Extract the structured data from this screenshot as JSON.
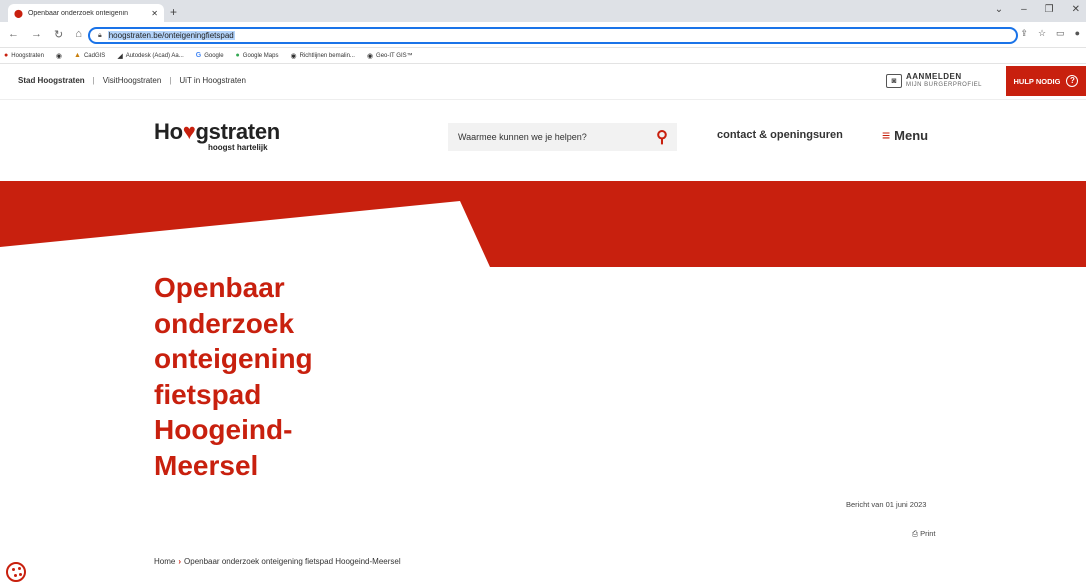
{
  "browser": {
    "tab_title": "Openbaar onderzoek onteigenin",
    "new_tab": "+",
    "url": "hoogstraten.be/onteigeningfietspad",
    "bookmarks": [
      "Hoogstraten",
      "CadGIS",
      "Autodesk (Acad) Aa...",
      "Google",
      "Google Maps",
      "Richtlijnen bemalin...",
      "Geo-IT GIS™"
    ]
  },
  "topbar": {
    "links": [
      "Stad Hoogstraten",
      "VisitHoogstraten",
      "UiT in Hoogstraten"
    ],
    "login_line1": "AANMELDEN",
    "login_line2": "MIJN BURGERPROFIEL",
    "help_label": "HULP NODIG"
  },
  "header": {
    "logo_text_start": "Ho",
    "logo_text_end": "gstraten",
    "logo_tagline": "hoogst hartelijk",
    "search_placeholder": "Waarmee kunnen we je helpen?",
    "contact_label": "contact & openingsuren",
    "menu_label": "Menu"
  },
  "colors": {
    "brand": "#c8200e"
  },
  "page": {
    "title_lines": [
      "Openbaar",
      "onderzoek",
      "onteigening",
      "fietspad",
      "Hoogeind-",
      "Meersel"
    ],
    "date": "Bericht van 01 juni 2023",
    "print_label": "Print",
    "breadcrumb_home": "Home",
    "breadcrumb_current": "Openbaar onderzoek onteigening fietspad Hoogeind-Meersel"
  }
}
